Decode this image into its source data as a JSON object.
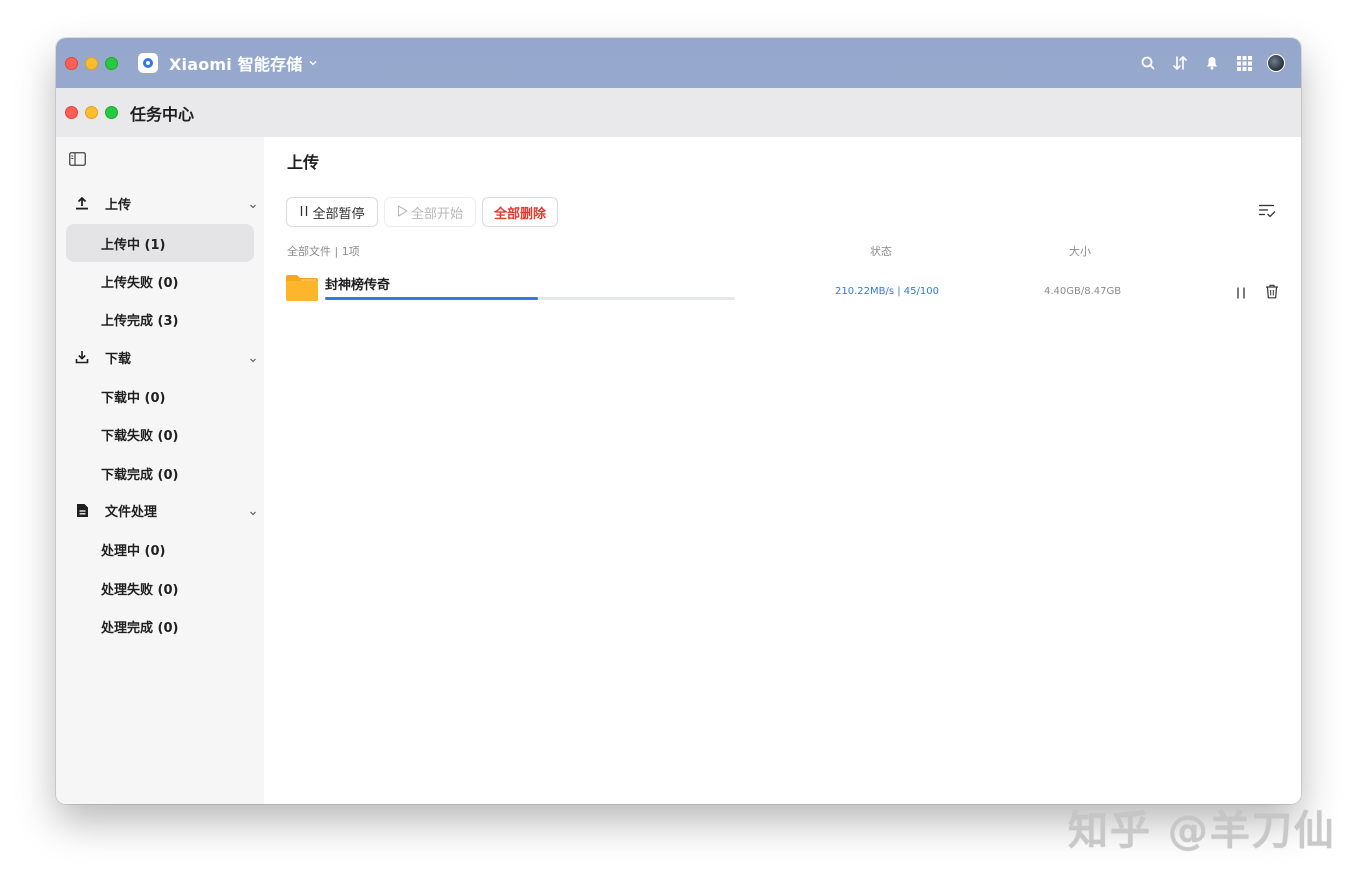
{
  "app": {
    "title": "Xiaomi 智能存储"
  },
  "window": {
    "title": "任务中心"
  },
  "sidebar": {
    "groups": [
      {
        "label": "上传",
        "icon": "upload-icon",
        "items": [
          {
            "label": "上传中 (1)",
            "active": true
          },
          {
            "label": "上传失败 (0)",
            "active": false
          },
          {
            "label": "上传完成 (3)",
            "active": false
          }
        ]
      },
      {
        "label": "下载",
        "icon": "download-icon",
        "items": [
          {
            "label": "下载中 (0)",
            "active": false
          },
          {
            "label": "下载失败 (0)",
            "active": false
          },
          {
            "label": "下载完成 (0)",
            "active": false
          }
        ]
      },
      {
        "label": "文件处理",
        "icon": "document-icon",
        "items": [
          {
            "label": "处理中 (0)",
            "active": false
          },
          {
            "label": "处理失败 (0)",
            "active": false
          },
          {
            "label": "处理完成 (0)",
            "active": false
          }
        ]
      }
    ]
  },
  "main": {
    "title": "上传",
    "toolbar": {
      "pause_all": "全部暂停",
      "start_all": "全部开始",
      "delete_all": "全部删除"
    },
    "columns": {
      "files": "全部文件 | 1项",
      "status": "状态",
      "size": "大小"
    },
    "rows": [
      {
        "name": "封神榜传奇",
        "status": "210.22MB/s | 45/100",
        "size": "4.40GB/8.47GB",
        "progress": 0.52
      }
    ]
  },
  "watermark": "知乎 @羊刀仙",
  "colors": {
    "accent": "#2f7ae6",
    "danger": "#e23a2c",
    "titlebar": "#95a7cc",
    "folder": "#fbb62c"
  }
}
